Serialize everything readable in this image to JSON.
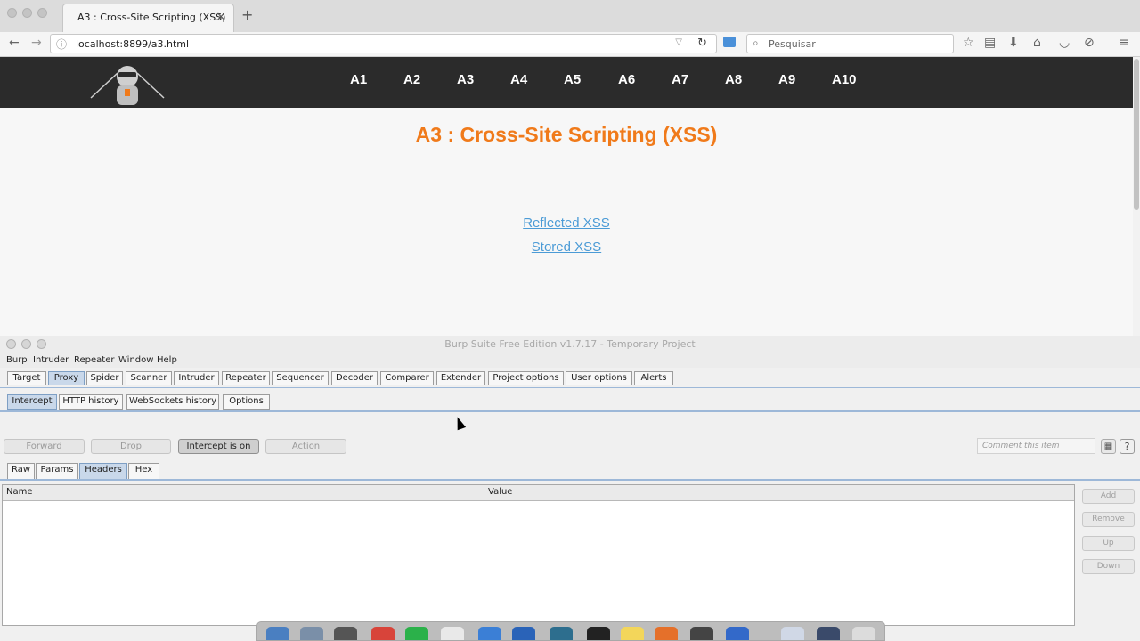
{
  "browser": {
    "tab_title": "A3 : Cross-Site Scripting (XSS)",
    "url": "localhost:8899/a3.html",
    "search_placeholder": "Pesquisar"
  },
  "site": {
    "nav_links": [
      "A1",
      "A2",
      "A3",
      "A4",
      "A5",
      "A6",
      "A7",
      "A8",
      "A9",
      "A10"
    ],
    "title": "A3 : Cross-Site Scripting (XSS)",
    "links": [
      "Reflected XSS",
      "Stored XSS"
    ]
  },
  "burp": {
    "window_title": "Burp Suite Free Edition v1.7.17 - Temporary Project",
    "menu": [
      "Burp",
      "Intruder",
      "Repeater",
      "Window",
      "Help"
    ],
    "main_tabs": [
      "Target",
      "Proxy",
      "Spider",
      "Scanner",
      "Intruder",
      "Repeater",
      "Sequencer",
      "Decoder",
      "Comparer",
      "Extender",
      "Project options",
      "User options",
      "Alerts"
    ],
    "active_main_tab": "Proxy",
    "proxy_tabs": [
      "Intercept",
      "HTTP history",
      "WebSockets history",
      "Options"
    ],
    "active_proxy_tab": "Intercept",
    "buttons": {
      "forward": "Forward",
      "drop": "Drop",
      "intercept": "Intercept is on",
      "action": "Action"
    },
    "comment_placeholder": "Comment this item",
    "help": "?",
    "view_tabs": [
      "Raw",
      "Params",
      "Headers",
      "Hex"
    ],
    "active_view_tab": "Headers",
    "table_columns": [
      "Name",
      "Value"
    ],
    "side_buttons": [
      "Add",
      "Remove",
      "Up",
      "Down"
    ]
  },
  "colors": {
    "site_title": "#f07a1a",
    "site_nav_bg": "#2b2b2b",
    "link": "#4b9bd6",
    "active_tab": "#c9d8ea"
  }
}
